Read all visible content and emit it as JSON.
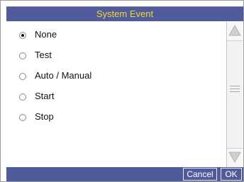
{
  "dialog": {
    "title": "System Event"
  },
  "options": [
    {
      "label": "None",
      "selected": true
    },
    {
      "label": "Test",
      "selected": false
    },
    {
      "label": "Auto / Manual",
      "selected": false
    },
    {
      "label": "Start",
      "selected": false
    },
    {
      "label": "Stop",
      "selected": false
    }
  ],
  "scrollbar": {
    "up_icon": "triangle-up",
    "down_icon": "triangle-down",
    "grip_icon": "three-line-grip"
  },
  "buttons": {
    "cancel_label": "Cancel",
    "ok_label": "OK"
  },
  "colors": {
    "title_bar": "#4f5b9b",
    "title_text": "#f2d634",
    "button_text": "#ffffff"
  }
}
